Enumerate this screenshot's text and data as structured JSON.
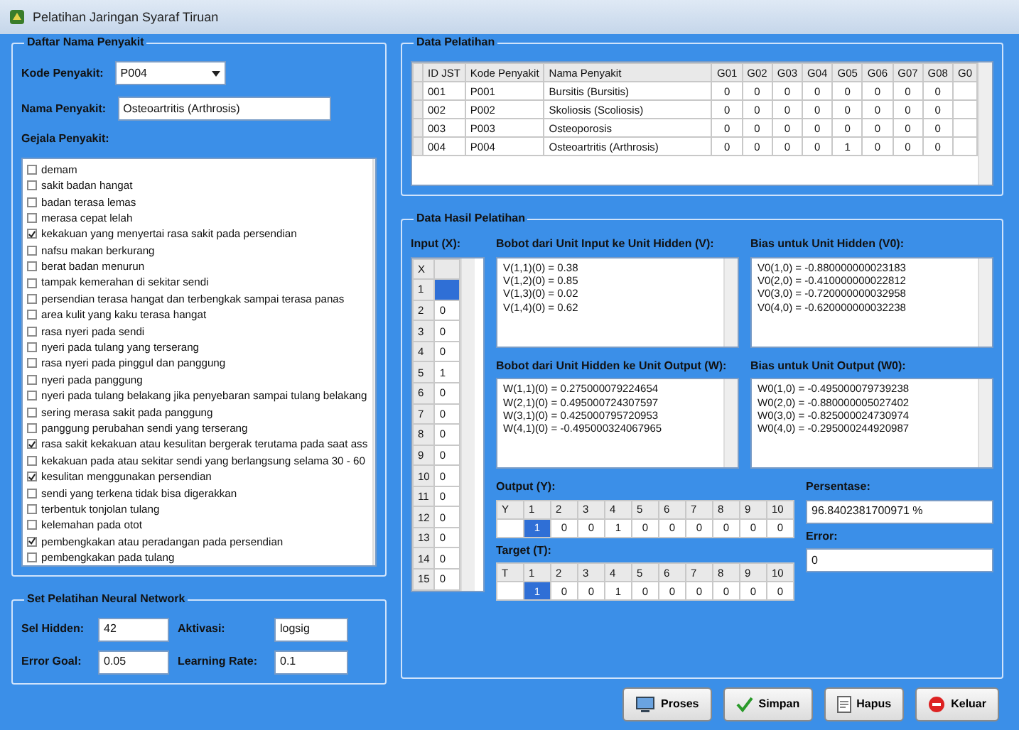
{
  "window": {
    "title": "Pelatihan Jaringan Syaraf Tiruan"
  },
  "disease_group": {
    "title": "Daftar Nama Penyakit",
    "code_label": "Kode Penyakit:",
    "code_value": "P004",
    "name_label": "Nama Penyakit:",
    "name_value": "Osteoartritis (Arthrosis)",
    "symptoms_label": "Gejala Penyakit:",
    "symptoms": [
      {
        "label": "demam",
        "checked": false
      },
      {
        "label": "sakit badan hangat",
        "checked": false
      },
      {
        "label": "badan terasa lemas",
        "checked": false
      },
      {
        "label": "merasa cepat lelah",
        "checked": false
      },
      {
        "label": "kekakuan yang menyertai rasa sakit pada persendian",
        "checked": true
      },
      {
        "label": "nafsu makan berkurang",
        "checked": false
      },
      {
        "label": "berat badan menurun",
        "checked": false
      },
      {
        "label": "tampak kemerahan di sekitar sendi",
        "checked": false
      },
      {
        "label": "persendian terasa hangat dan terbengkak sampai terasa panas",
        "checked": false
      },
      {
        "label": "area kulit yang kaku terasa hangat",
        "checked": false
      },
      {
        "label": "rasa nyeri pada sendi",
        "checked": false
      },
      {
        "label": "nyeri pada tulang yang terserang",
        "checked": false
      },
      {
        "label": "rasa nyeri pada pinggul dan panggung",
        "checked": false
      },
      {
        "label": "nyeri pada panggung",
        "checked": false
      },
      {
        "label": "nyeri pada tulang belakang jika penyebaran sampai tulang belakang",
        "checked": false
      },
      {
        "label": "sering merasa sakit pada panggung",
        "checked": false
      },
      {
        "label": "panggung perubahan sendi yang terserang",
        "checked": false
      },
      {
        "label": "rasa sakit kekakuan atau kesulitan bergerak terutama pada saat ass",
        "checked": true
      },
      {
        "label": "kekakuan pada atau sekitar sendi yang berlangsung selama 30 - 60",
        "checked": false
      },
      {
        "label": "kesulitan menggunakan persendian",
        "checked": true
      },
      {
        "label": "sendi yang terkena tidak bisa digerakkan",
        "checked": false
      },
      {
        "label": "terbentuk tonjolan tulang",
        "checked": false
      },
      {
        "label": "kelemahan pada otot",
        "checked": false
      },
      {
        "label": "pembengkakan atau peradangan pada persendian",
        "checked": true
      },
      {
        "label": "pembengkakan pada tulang",
        "checked": false
      }
    ]
  },
  "params_group": {
    "title": "Set Pelatihan Neural Network",
    "fields": [
      {
        "label": "Sel Hidden:",
        "value": "42"
      },
      {
        "label": "Aktivasi:",
        "value": "logsig"
      },
      {
        "label": "Error Goal:",
        "value": "0.05"
      },
      {
        "label": "Learning Rate:",
        "value": "0.1"
      }
    ]
  },
  "training_data": {
    "title": "Data Pelatihan",
    "columns": [
      "ID JST",
      "Kode Penyakit",
      "Nama Penyakit",
      "G01",
      "G02",
      "G03",
      "G04",
      "G05",
      "G06",
      "G07",
      "G08",
      "G0"
    ],
    "rows": [
      {
        "cells": [
          "001",
          "P001",
          "Bursitis (Bursitis)",
          "0",
          "0",
          "0",
          "0",
          "0",
          "0",
          "0",
          "0"
        ]
      },
      {
        "cells": [
          "002",
          "P002",
          "Skoliosis (Scoliosis)",
          "0",
          "0",
          "0",
          "0",
          "0",
          "0",
          "0",
          "0"
        ]
      },
      {
        "cells": [
          "003",
          "P003",
          "Osteoporosis",
          "0",
          "0",
          "0",
          "0",
          "0",
          "0",
          "0",
          "0"
        ]
      },
      {
        "cells": [
          "004",
          "P004",
          "Osteoartritis (Arthrosis)",
          "0",
          "0",
          "0",
          "0",
          "1",
          "0",
          "0",
          "0"
        ]
      }
    ]
  },
  "results": {
    "title": "Data Hasil Pelatihan",
    "input": {
      "label": "Input (X):",
      "header": [
        "X"
      ],
      "rows": [
        {
          "index": "1",
          "selected": true
        },
        {
          "index": "2",
          "value": "0",
          "selected": false
        },
        {
          "index": "3",
          "value": "0",
          "selected": false
        },
        {
          "index": "4",
          "value": "0",
          "selected": false
        },
        {
          "index": "5",
          "value": "1",
          "selected": false
        },
        {
          "index": "6",
          "value": "0",
          "selected": false
        },
        {
          "index": "7",
          "value": "0",
          "selected": false
        },
        {
          "index": "8",
          "value": "0",
          "selected": false
        },
        {
          "index": "9",
          "value": "0",
          "selected": false
        },
        {
          "index": "10",
          "value": "0",
          "selected": false
        },
        {
          "index": "11",
          "value": "0",
          "selected": false
        },
        {
          "index": "12",
          "value": "0",
          "selected": false
        },
        {
          "index": "13",
          "value": "0",
          "selected": false
        },
        {
          "index": "14",
          "value": "0",
          "selected": false
        },
        {
          "index": "15",
          "value": "0",
          "selected": false
        }
      ]
    },
    "weights": [
      {
        "label": "Bobot dari Unit Input ke Unit Hidden (V):",
        "lines": [
          "V(1,1)(0) = 0.38",
          "V(1,2)(0) = 0.85",
          "V(1,3)(0) = 0.02",
          "V(1,4)(0) = 0.62"
        ]
      },
      {
        "label": "Bias untuk Unit Hidden (V0):",
        "lines": [
          "V0(1,0) = -0.880000000023183",
          "V0(2,0) = -0.410000000022812",
          "V0(3,0) = -0.720000000032958",
          "V0(4,0) = -0.620000000032238"
        ]
      },
      {
        "label": "Bobot dari Unit Hidden ke Unit Output (W):",
        "lines": [
          "W(1,1)(0) = 0.275000079224654",
          "W(2,1)(0) = 0.495000724307597",
          "W(3,1)(0) = 0.425000795720953",
          "W(4,1)(0) = -0.495000324067965"
        ]
      },
      {
        "label": "Bias untuk Unit Output (W0):",
        "lines": [
          "W0(1,0) = -0.495000079739238",
          "W0(2,0) = -0.880000005027402",
          "W0(3,0) = -0.825000024730974",
          "W0(4,0) = -0.295000244920987"
        ]
      }
    ],
    "output": {
      "label": "Output (Y):",
      "header": [
        "Y",
        "1",
        "2",
        "3",
        "4",
        "5",
        "6",
        "7",
        "8",
        "9",
        "10"
      ],
      "cells": [
        {
          "selected": false
        },
        {
          "text": "1",
          "selected": true
        },
        {
          "text": "0",
          "selected": false
        },
        {
          "text": "0",
          "selected": false
        },
        {
          "text": "1",
          "selected": false
        },
        {
          "text": "0",
          "selected": false
        },
        {
          "text": "0",
          "selected": false
        },
        {
          "text": "0",
          "selected": false
        },
        {
          "text": "0",
          "selected": false
        },
        {
          "text": "0",
          "selected": false
        },
        {
          "text": "0",
          "selected": false
        }
      ]
    },
    "target": {
      "label": "Target (T):",
      "header": [
        "T",
        "1",
        "2",
        "3",
        "4",
        "5",
        "6",
        "7",
        "8",
        "9",
        "10"
      ],
      "cells": [
        {
          "selected": false
        },
        {
          "text": "1",
          "selected": true
        },
        {
          "text": "0",
          "selected": false
        },
        {
          "text": "0",
          "selected": false
        },
        {
          "text": "1",
          "selected": false
        },
        {
          "text": "0",
          "selected": false
        },
        {
          "text": "0",
          "selected": false
        },
        {
          "text": "0",
          "selected": false
        },
        {
          "text": "0",
          "selected": false
        },
        {
          "text": "0",
          "selected": false
        },
        {
          "text": "0",
          "selected": false
        }
      ]
    },
    "percentage": {
      "label": "Persentase:",
      "value": "96.8402381700971 %"
    },
    "error": {
      "label": "Error:",
      "value": "0"
    }
  },
  "buttons": [
    {
      "label": "Proses",
      "kind": "process"
    },
    {
      "label": "Simpan",
      "kind": "save"
    },
    {
      "label": "Hapus",
      "kind": "clear"
    },
    {
      "label": "Keluar",
      "kind": "exit"
    }
  ]
}
